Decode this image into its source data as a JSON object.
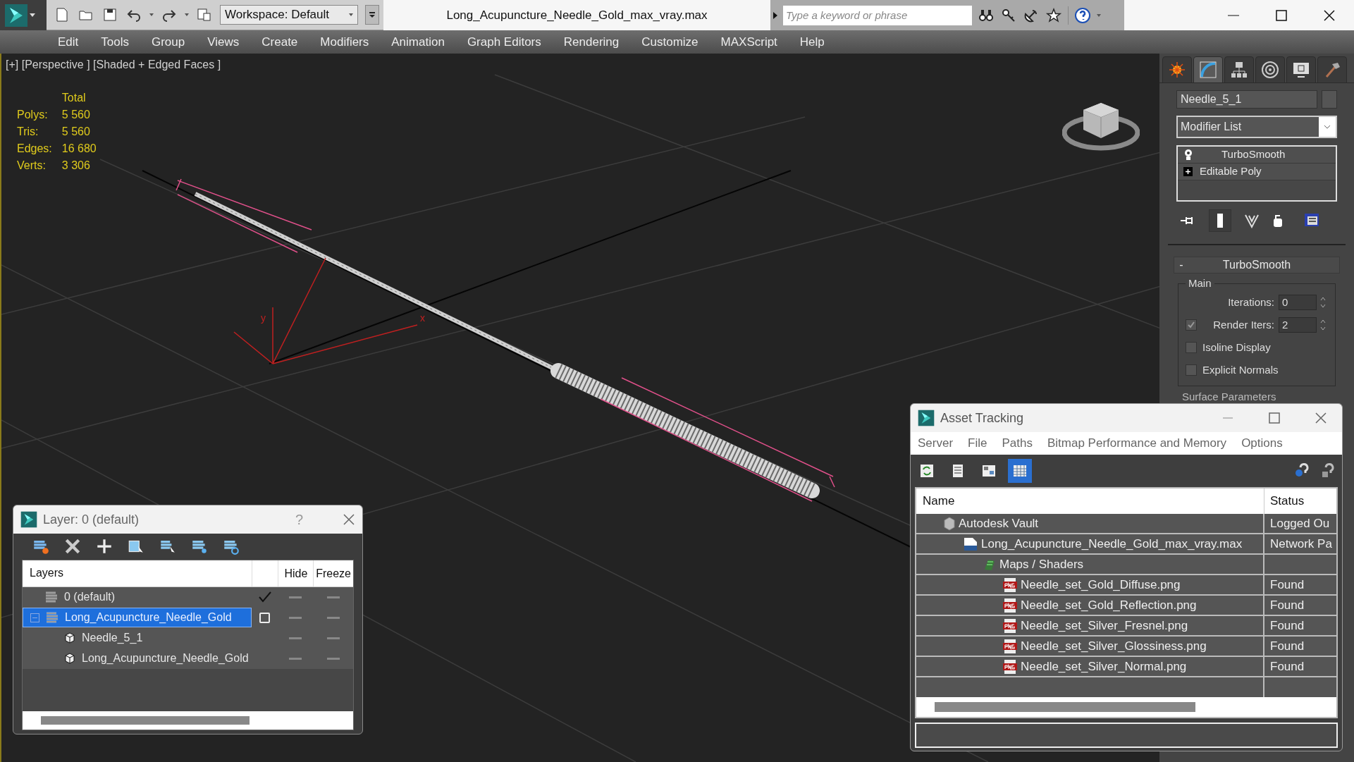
{
  "window": {
    "title": "Long_Acupuncture_Needle_Gold_max_vray.max"
  },
  "workspace": {
    "value": "Workspace: Default"
  },
  "search": {
    "placeholder": "Type a keyword or phrase"
  },
  "menu": [
    "Edit",
    "Tools",
    "Group",
    "Views",
    "Create",
    "Modifiers",
    "Animation",
    "Graph Editors",
    "Rendering",
    "Customize",
    "MAXScript",
    "Help"
  ],
  "viewport": {
    "label": "[+] [Perspective ] [Shaded + Edged Faces ]",
    "stats_header": "Total",
    "stats": [
      {
        "label": "Polys:",
        "value": "5 560"
      },
      {
        "label": "Tris:",
        "value": "5 560"
      },
      {
        "label": "Edges:",
        "value": "16 680"
      },
      {
        "label": "Verts:",
        "value": "3 306"
      }
    ],
    "gizmo": {
      "x_label": "x",
      "y_label": "y"
    }
  },
  "command_panel": {
    "tabs": [
      {
        "kind": "create",
        "selected": false
      },
      {
        "kind": "modify",
        "selected": true
      },
      {
        "kind": "hierarchy",
        "selected": false
      },
      {
        "kind": "motion",
        "selected": false
      },
      {
        "kind": "display",
        "selected": false
      },
      {
        "kind": "utilities",
        "selected": false
      }
    ],
    "object_name": "Needle_5_1",
    "modifier_list": "Modifier List",
    "stack": [
      {
        "kind": "bulb",
        "label": "TurboSmooth"
      },
      {
        "kind": "plus",
        "label": "Editable Poly"
      }
    ],
    "rollout": {
      "title": "TurboSmooth",
      "collapse": "-",
      "group": "Main",
      "spinners": [
        {
          "label": "Iterations:",
          "value": "0"
        },
        {
          "label": "Render Iters:",
          "value": "2",
          "checked": true
        }
      ],
      "checkboxes": [
        {
          "label": "Isoline Display",
          "checked": false
        },
        {
          "label": "Explicit Normals",
          "checked": false
        }
      ]
    },
    "next_rollout": "Surface Parameters"
  },
  "layers": {
    "title": "Layer: 0 (default)",
    "help": "?",
    "columns": [
      "Layers",
      "Hide",
      "Freeze"
    ],
    "rows": [
      {
        "name": "0 (default)",
        "current": true,
        "selected": false,
        "children": []
      },
      {
        "name": "Long_Acupuncture_Needle_Gold",
        "current": false,
        "selected": true,
        "expanded": true,
        "children": [
          {
            "name": "Needle_5_1"
          },
          {
            "name": "Long_Acupuncture_Needle_Gold"
          }
        ]
      }
    ]
  },
  "asset_tracking": {
    "title": "Asset Tracking",
    "menu": [
      "Server",
      "File",
      "Paths",
      "Bitmap Performance and Memory",
      "Options"
    ],
    "toolbar": [
      {
        "kind": "refresh",
        "selected": false
      },
      {
        "kind": "list",
        "selected": false
      },
      {
        "kind": "thumbnails",
        "selected": false
      },
      {
        "kind": "grid",
        "selected": true
      }
    ],
    "columns": [
      "Name",
      "Status"
    ],
    "tree": [
      {
        "kind": "vault",
        "name": "Autodesk Vault",
        "status": "Logged Ou",
        "children": [
          {
            "kind": "max",
            "name": "Long_Acupuncture_Needle_Gold_max_vray.max",
            "status": "Network Pa",
            "children": [
              {
                "kind": "maps",
                "name": "Maps / Shaders",
                "children": [
                  {
                    "kind": "png",
                    "name": "Needle_set_Gold_Diffuse.png",
                    "status": "Found"
                  },
                  {
                    "kind": "png",
                    "name": "Needle_set_Gold_Reflection.png",
                    "status": "Found"
                  },
                  {
                    "kind": "png",
                    "name": "Needle_set_Silver_Fresnel.png",
                    "status": "Found"
                  },
                  {
                    "kind": "png",
                    "name": "Needle_set_Silver_Glossiness.png",
                    "status": "Found"
                  },
                  {
                    "kind": "png",
                    "name": "Needle_set_Silver_Normal.png",
                    "status": "Found"
                  }
                ]
              }
            ]
          }
        ]
      }
    ]
  }
}
